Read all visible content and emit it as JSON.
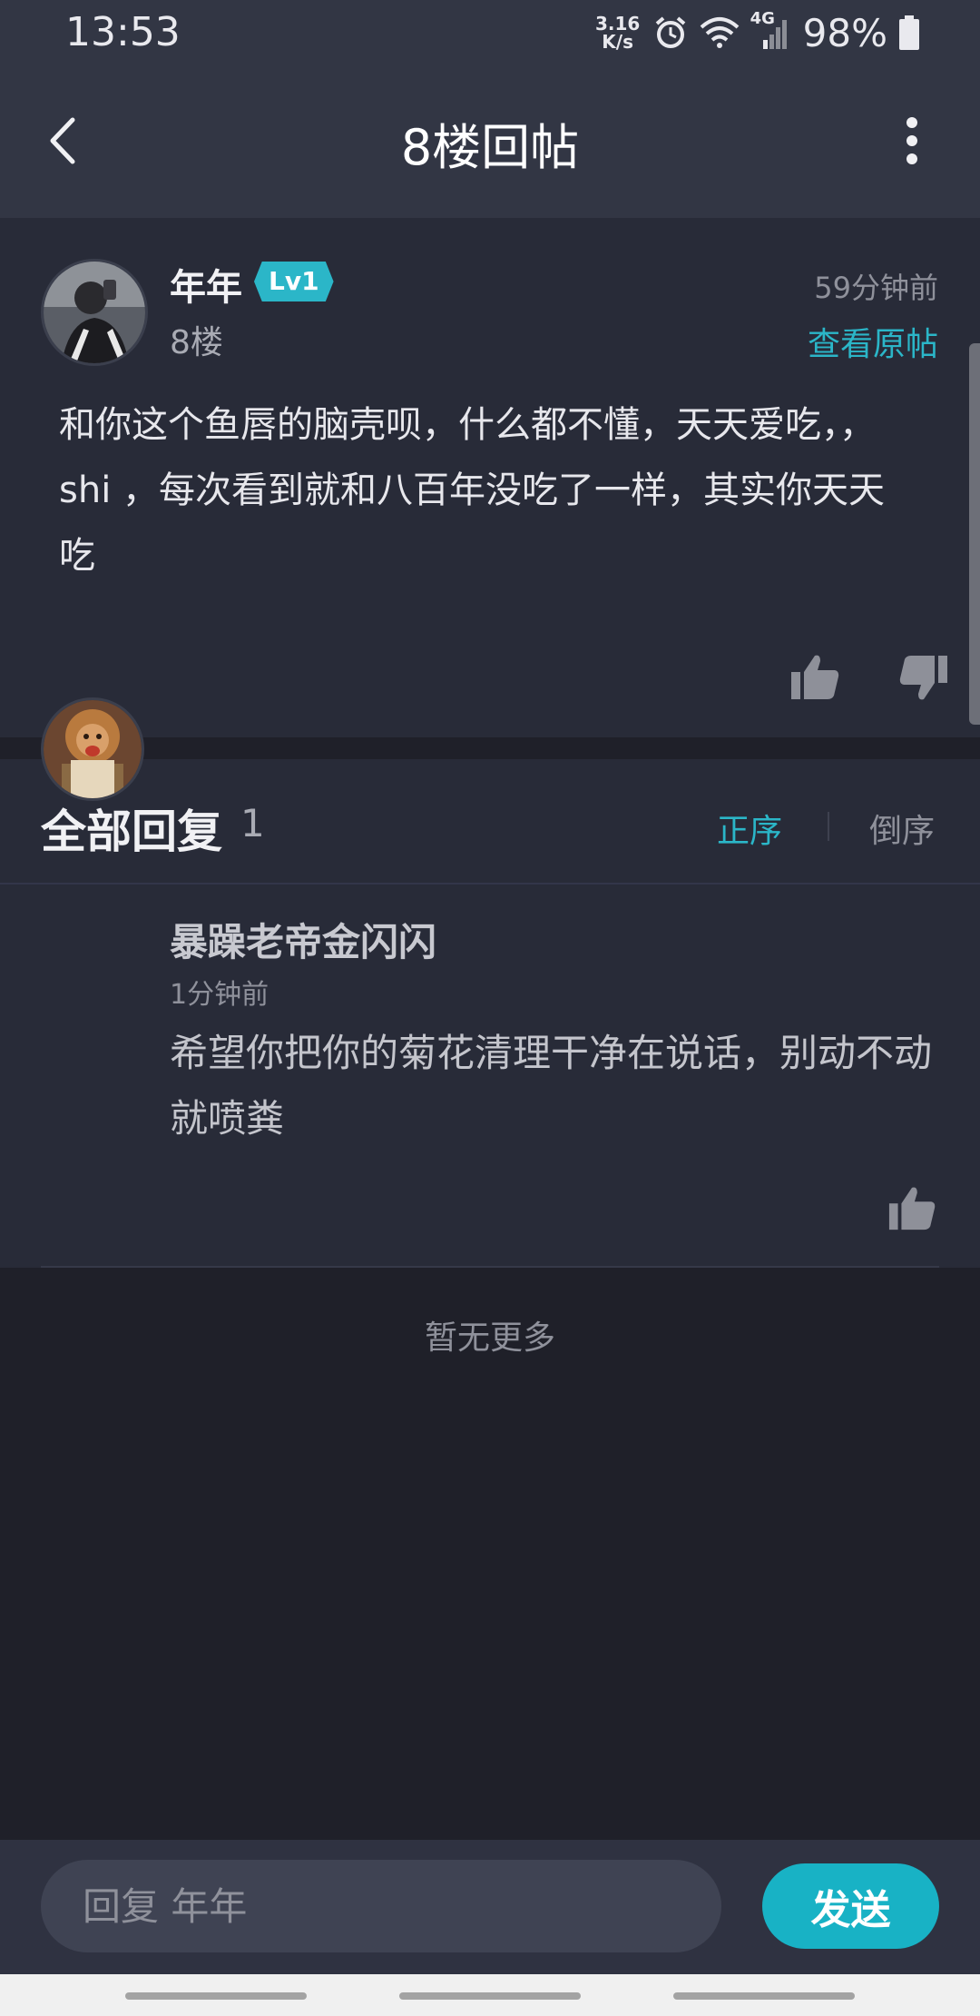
{
  "status_bar": {
    "time": "13:53",
    "net_speed_value": "3.16",
    "net_speed_unit": "K/s",
    "network": "4G",
    "battery": "98%"
  },
  "header": {
    "title": "8楼回帖"
  },
  "post": {
    "author": "年年",
    "level": "Lv1",
    "floor": "8楼",
    "time": "59分钟前",
    "view_original_label": "查看原帖",
    "content": "和你这个鱼唇的脑壳呗，什么都不懂，天天爱吃，，shi ，每次看到就和八百年没吃了一样，其实你天天吃"
  },
  "replies": {
    "title": "全部回复",
    "count": "1",
    "sort_asc_label": "正序",
    "sort_desc_label": "倒序",
    "items": [
      {
        "author": "暴躁老帝金闪闪",
        "time": "1分钟前",
        "content": "希望你把你的菊花清理干净在说话，别动不动就喷粪"
      }
    ],
    "no_more_text": "暂无更多"
  },
  "composer": {
    "placeholder": "回复 年年",
    "send_label": "发送"
  },
  "colors": {
    "accent": "#18b2c5",
    "background": "#1f2029",
    "card": "#282b38",
    "topbar": "#323644"
  }
}
